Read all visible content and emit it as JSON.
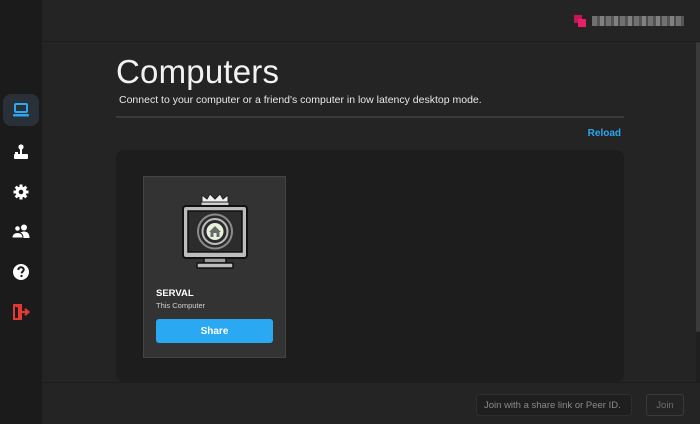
{
  "sidebar": {
    "items": [
      {
        "icon": "computer-icon",
        "active": true
      },
      {
        "icon": "joystick-icon",
        "active": false
      },
      {
        "icon": "gear-icon",
        "active": false
      },
      {
        "icon": "users-icon",
        "active": false
      },
      {
        "icon": "help-icon",
        "active": false
      },
      {
        "icon": "logout-icon",
        "active": false
      }
    ]
  },
  "header": {
    "title": "Computers",
    "subtitle": "Connect to your computer or a friend's computer in low latency desktop mode.",
    "reload_label": "Reload"
  },
  "user": {
    "name": ""
  },
  "computers": [
    {
      "name": "SERVAL",
      "subtitle": "This Computer",
      "action_label": "Share",
      "icon": "home-monitor-icon"
    }
  ],
  "join": {
    "placeholder": "Join with a share link or Peer ID.",
    "value": "",
    "button_label": "Join"
  },
  "colors": {
    "accent": "#2aa8f2",
    "logout": "#e53935",
    "background": "#242424",
    "sidebar": "#1b1b1b",
    "panel": "#1d1d1d"
  }
}
